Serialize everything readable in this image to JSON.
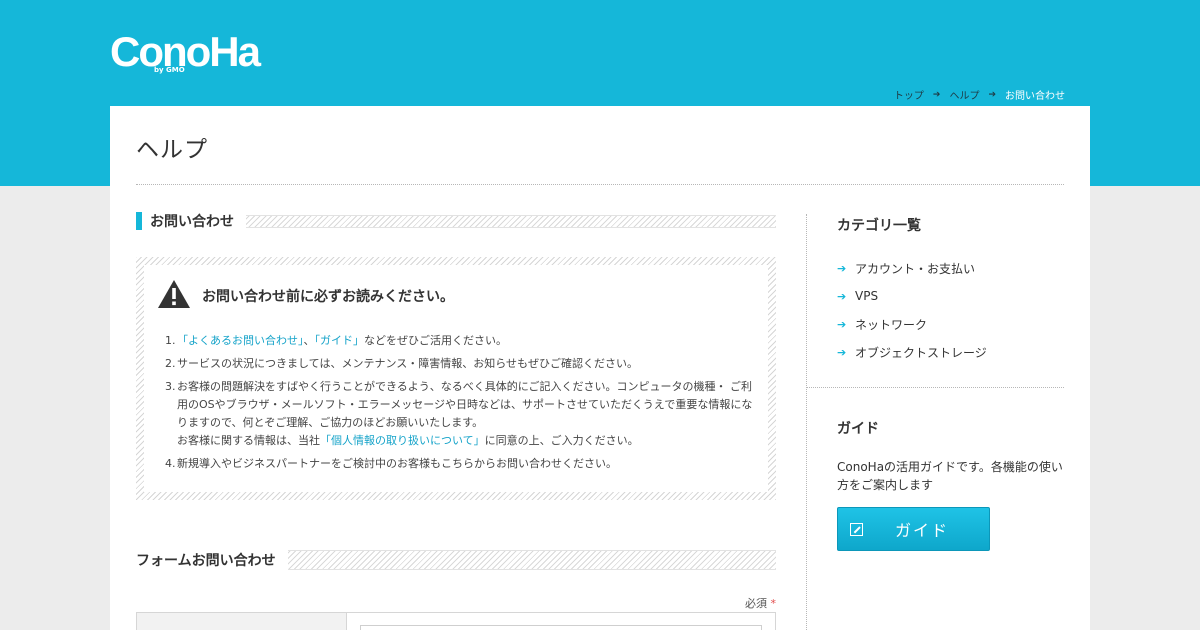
{
  "header": {
    "logo_text": "ConoHa",
    "logo_sub": "by GMO",
    "breadcrumb": [
      "トップ",
      "ヘルプ",
      "お問い合わせ"
    ]
  },
  "page": {
    "title": "ヘルプ"
  },
  "main": {
    "section_title": "お問い合わせ",
    "notice": {
      "title": "お問い合わせ前に必ずお読みください。",
      "items": {
        "i1_link1": "「よくあるお問い合わせ」",
        "i1_sep": "、",
        "i1_link2": "「ガイド」",
        "i1_rest": "などをぜひご活用ください。",
        "i2": "サービスの状況につきましては、メンテナンス・障害情報、お知らせもぜひご確認ください。",
        "i3_line1": "お客様の問題解決をすばやく行うことができるよう、なるべく具体的にご記入ください。コンピュータの機種・ ご利用のOSやブラウザ・メールソフト・エラーメッセージや日時などは、サポートさせていただくうえで重要な情報になりますので、何とぞご理解、ご協力のほどお願いいたします。",
        "i3_line2_pre": "お客様に関する情報は、当社",
        "i3_link": "「個人情報の取り扱いについて」",
        "i3_line2_post": "に同意の上、ご入力ください。",
        "i4": "新規導入やビジネスパートナーをご検討中のお客様もこちらからお問い合わせください。"
      }
    },
    "form_title": "フォームお問い合わせ",
    "required_label": "必須",
    "required_mark": "*"
  },
  "sidebar": {
    "category_title": "カテゴリ一覧",
    "categories": [
      "アカウント・お支払い",
      "VPS",
      "ネットワーク",
      "オブジェクトストレージ"
    ],
    "guide_title": "ガイド",
    "guide_desc": "ConoHaの活用ガイドです。各機能の使い方をご案内します",
    "guide_button": "ガイド"
  },
  "colors": {
    "brand": "#15b7d9",
    "link": "#15a3c9",
    "required": "#e24b4b"
  }
}
